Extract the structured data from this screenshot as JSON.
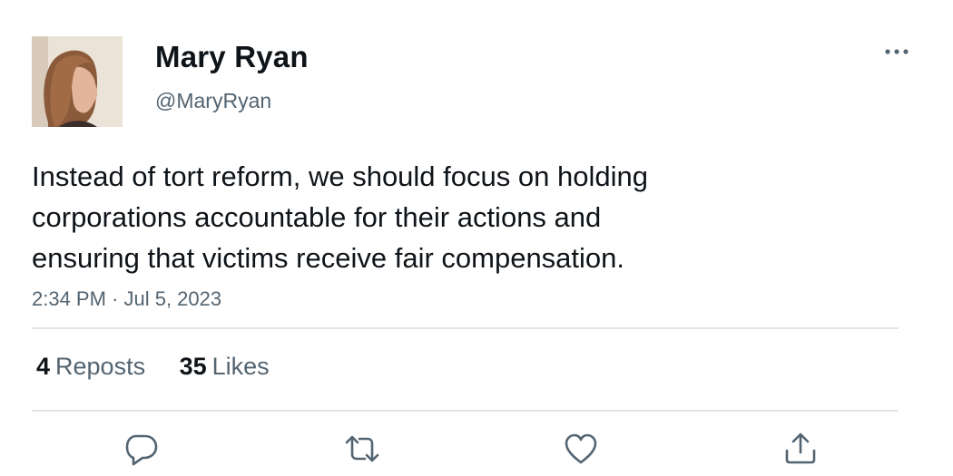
{
  "author": {
    "display_name": "Mary Ryan",
    "handle": "@MaryRyan"
  },
  "tweet": {
    "text_lines": [
      "Instead of tort reform, we should focus on holding",
      "corporations accountable for their actions and",
      "ensuring that victims receive fair compensation."
    ],
    "timestamp": "2:34 PM · Jul 5, 2023"
  },
  "stats": {
    "reposts_count": "4",
    "reposts_label": "Reposts",
    "likes_count": "35",
    "likes_label": "Likes"
  },
  "icons": {
    "more": "more-horizontal-icon",
    "reply": "reply-bubble-icon",
    "repost": "repost-arrows-icon",
    "like": "heart-icon",
    "share": "share-upload-icon"
  },
  "colors": {
    "text_primary": "#0f1419",
    "text_secondary": "#536471",
    "divider": "#e1e5e8",
    "icon": "#536471"
  }
}
